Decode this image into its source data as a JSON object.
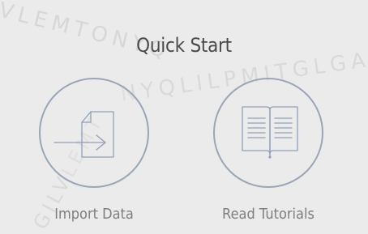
{
  "quick_start": {
    "title": "Quick Start",
    "actions": [
      {
        "label": "Import Data",
        "icon": "import-icon"
      },
      {
        "label": "Read Tutorials",
        "icon": "book-icon"
      }
    ]
  },
  "watermark": {
    "arc_text": "VLEMTONYQ",
    "line_text": "NYQLILPMITGLGA",
    "vertical_text": "GILVLEMT",
    "color": "#d6d6d6"
  },
  "colors": {
    "background": "#ebebeb",
    "circle_border": "#9aa6b6",
    "icon_stroke": "#8fa0b8",
    "title": "#4a4a4a",
    "label": "#7e7e7e"
  }
}
